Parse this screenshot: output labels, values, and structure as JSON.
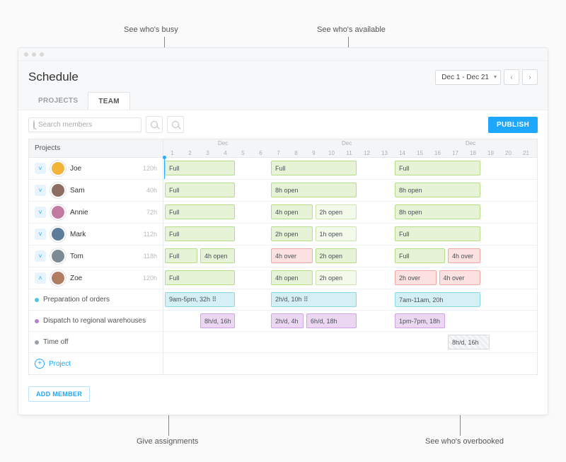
{
  "annotations": {
    "top_left": "See who's busy",
    "top_right": "See who's available",
    "bottom_left": "Give assignments",
    "bottom_right": "See who's overbooked"
  },
  "header": {
    "title": "Schedule",
    "date_range": "Dec 1 - Dec 21"
  },
  "tabs": {
    "projects": "PROJECTS",
    "team": "TEAM"
  },
  "toolbar": {
    "search_placeholder": "Search members",
    "publish": "PUBLISH"
  },
  "grid": {
    "side_header": "Projects",
    "month_label": "Dec",
    "days": [
      "1",
      "2",
      "3",
      "4",
      "5",
      "6",
      "7",
      "8",
      "9",
      "10",
      "11",
      "12",
      "13",
      "14",
      "15",
      "16",
      "17",
      "18",
      "19",
      "20",
      "21"
    ]
  },
  "members": [
    {
      "name": "Joe",
      "hours": "120h",
      "avatar_bg": "#f3b43a",
      "bars": [
        {
          "txt": "Full",
          "cls": "full",
          "l": 0,
          "w": 4.1
        },
        {
          "txt": "Full",
          "cls": "full",
          "l": 6,
          "w": 5
        },
        {
          "txt": "Full",
          "cls": "full",
          "l": 13,
          "w": 5
        }
      ]
    },
    {
      "name": "Sam",
      "hours": "40h",
      "avatar_bg": "#8d6e63",
      "bars": [
        {
          "txt": "Full",
          "cls": "full",
          "l": 0,
          "w": 4.1
        },
        {
          "txt": "8h open",
          "cls": "open",
          "l": 6,
          "w": 5
        },
        {
          "txt": "8h open",
          "cls": "open",
          "l": 13,
          "w": 5
        }
      ]
    },
    {
      "name": "Annie",
      "hours": "72h",
      "avatar_bg": "#c27ba0",
      "bars": [
        {
          "txt": "Full",
          "cls": "full",
          "l": 0,
          "w": 4.1
        },
        {
          "txt": "4h open",
          "cls": "open",
          "l": 6,
          "w": 2.5
        },
        {
          "txt": "2h open",
          "cls": "open2",
          "l": 8.5,
          "w": 2.5
        },
        {
          "txt": "8h open",
          "cls": "open",
          "l": 13,
          "w": 5
        }
      ]
    },
    {
      "name": "Mark",
      "hours": "112h",
      "avatar_bg": "#5e7d9a",
      "bars": [
        {
          "txt": "Full",
          "cls": "full",
          "l": 0,
          "w": 4.1
        },
        {
          "txt": "2h open",
          "cls": "open",
          "l": 6,
          "w": 2.5
        },
        {
          "txt": "1h open",
          "cls": "open2",
          "l": 8.5,
          "w": 2.5
        },
        {
          "txt": "Full",
          "cls": "full",
          "l": 13,
          "w": 5
        }
      ]
    },
    {
      "name": "Tom",
      "hours": "118h",
      "avatar_bg": "#7c8a93",
      "bars": [
        {
          "txt": "Full",
          "cls": "full",
          "l": 0,
          "w": 2
        },
        {
          "txt": "4h open",
          "cls": "open",
          "l": 2,
          "w": 2.1
        },
        {
          "txt": "4h over",
          "cls": "over",
          "l": 6,
          "w": 2.5
        },
        {
          "txt": "2h open",
          "cls": "open",
          "l": 8.5,
          "w": 2.5
        },
        {
          "txt": "Full",
          "cls": "full",
          "l": 13,
          "w": 3
        },
        {
          "txt": "4h over",
          "cls": "over",
          "l": 16,
          "w": 2
        }
      ]
    },
    {
      "name": "Zoe",
      "hours": "120h",
      "avatar_bg": "#b07d62",
      "expanded": true,
      "bars": [
        {
          "txt": "Full",
          "cls": "full",
          "l": 0,
          "w": 4.1
        },
        {
          "txt": "4h open",
          "cls": "open",
          "l": 6,
          "w": 2.5
        },
        {
          "txt": "2h open",
          "cls": "open2",
          "l": 8.5,
          "w": 2.5
        },
        {
          "txt": "2h over",
          "cls": "over",
          "l": 13,
          "w": 2.5
        },
        {
          "txt": "4h over",
          "cls": "over",
          "l": 15.5,
          "w": 2.5
        }
      ]
    }
  ],
  "tasks": [
    {
      "name": "Preparation of orders",
      "dot": "c1",
      "bars": [
        {
          "txt": "9am-5pm, 32h ⠿",
          "cls": "prep",
          "l": 0,
          "w": 4.1
        },
        {
          "txt": "2h/d, 10h ⠿",
          "cls": "prep",
          "l": 6,
          "w": 5
        },
        {
          "txt": "7am-11am, 20h",
          "cls": "prep",
          "l": 13,
          "w": 5
        }
      ]
    },
    {
      "name": "Dispatch to regional warehouses",
      "dot": "c2",
      "bars": [
        {
          "txt": "8h/d, 16h",
          "cls": "disp",
          "l": 2,
          "w": 2.1
        },
        {
          "txt": "2h/d, 4h",
          "cls": "disp",
          "l": 6,
          "w": 2
        },
        {
          "txt": "6h/d, 18h",
          "cls": "disp",
          "l": 8,
          "w": 3
        },
        {
          "txt": "1pm-7pm, 18h",
          "cls": "disp",
          "l": 13,
          "w": 3
        }
      ]
    },
    {
      "name": "Time off",
      "dot": "c3",
      "bars": [
        {
          "txt": "8h/d, 16h",
          "cls": "timeoff",
          "l": 16,
          "w": 2.5
        }
      ]
    }
  ],
  "footer": {
    "add_project": "Project",
    "add_member": "ADD MEMBER"
  }
}
